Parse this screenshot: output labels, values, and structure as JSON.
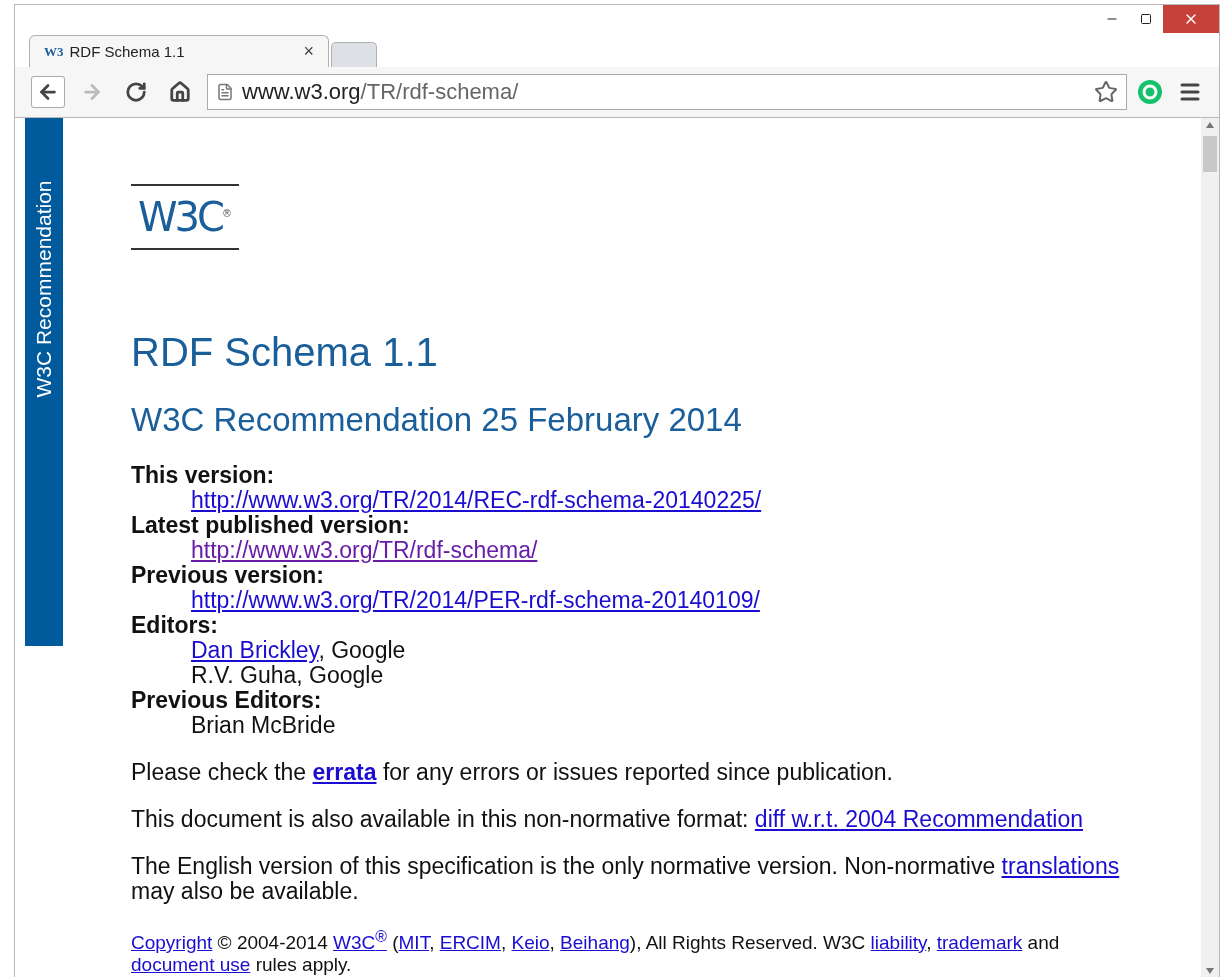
{
  "tabs": [
    {
      "favicon": "W3",
      "title": "RDF Schema 1.1",
      "close": "×",
      "selected": true
    }
  ],
  "address_bar": {
    "host": "www.w3.org",
    "path": "/TR/rdf-schema/",
    "starred": false
  },
  "sidebar": {
    "label": "W3C Recommendation"
  },
  "logo": {
    "text": "W3C",
    "mark": "®"
  },
  "title": "RDF Schema 1.1",
  "subtitle": "W3C Recommendation 25 February 2014",
  "details": [
    {
      "term": "This version:",
      "values": [
        [
          {
            "kind": "link",
            "text": "http://www.w3.org/TR/2014/REC-rdf-schema-20140225/",
            "visited": false
          }
        ]
      ]
    },
    {
      "term": "Latest published version:",
      "values": [
        [
          {
            "kind": "link",
            "text": "http://www.w3.org/TR/rdf-schema/",
            "visited": true
          }
        ]
      ]
    },
    {
      "term": "Previous version:",
      "values": [
        [
          {
            "kind": "link",
            "text": "http://www.w3.org/TR/2014/PER-rdf-schema-20140109/",
            "visited": false
          }
        ]
      ]
    },
    {
      "term": "Editors:",
      "values": [
        [
          {
            "kind": "link",
            "text": "Dan Brickley",
            "visited": false
          },
          {
            "kind": "text",
            "text": ", Google"
          }
        ],
        [
          {
            "kind": "text",
            "text": "R.V. Guha, Google"
          }
        ]
      ]
    },
    {
      "term": "Previous Editors:",
      "values": [
        [
          {
            "kind": "text",
            "text": "Brian McBride"
          }
        ]
      ]
    }
  ],
  "paragraphs": [
    [
      {
        "kind": "text",
        "text": "Please check the "
      },
      {
        "kind": "strong-link",
        "text": "errata"
      },
      {
        "kind": "text",
        "text": " for any errors or issues reported since publication."
      }
    ],
    [
      {
        "kind": "text",
        "text": "This document is also available in this non-normative format: "
      },
      {
        "kind": "link",
        "text": "diff w.r.t. 2004 Recommendation"
      }
    ],
    [
      {
        "kind": "text",
        "text": "The English version of this specification is the only normative version. Non-normative "
      },
      {
        "kind": "link",
        "text": "translations"
      },
      {
        "kind": "text",
        "text": " may also be available."
      }
    ]
  ],
  "copyright": [
    {
      "kind": "link",
      "text": "Copyright"
    },
    {
      "kind": "text",
      "text": " © 2004-2014 "
    },
    {
      "kind": "link",
      "text": "W3C$^{®}$"
    },
    {
      "kind": "text",
      "text": " ("
    },
    {
      "kind": "link",
      "text": "MIT"
    },
    {
      "kind": "text",
      "text": ", "
    },
    {
      "kind": "link",
      "text": "ERCIM"
    },
    {
      "kind": "text",
      "text": ", "
    },
    {
      "kind": "link",
      "text": "Keio"
    },
    {
      "kind": "text",
      "text": ", "
    },
    {
      "kind": "link",
      "text": "Beihang"
    },
    {
      "kind": "text",
      "text": "), All Rights Reserved. W3C "
    },
    {
      "kind": "link",
      "text": "liability"
    },
    {
      "kind": "text",
      "text": ", "
    },
    {
      "kind": "link",
      "text": "trademark"
    },
    {
      "kind": "text",
      "text": " and "
    },
    {
      "kind": "link",
      "text": "document use"
    },
    {
      "kind": "text",
      "text": " rules apply."
    }
  ]
}
